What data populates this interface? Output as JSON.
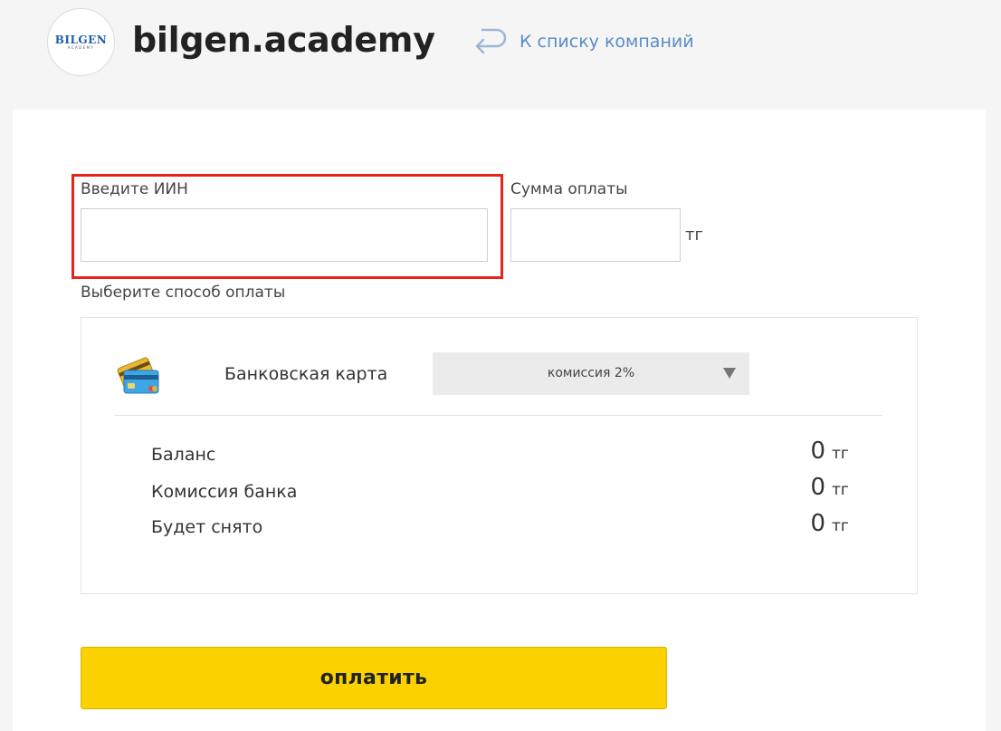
{
  "header": {
    "logo_main": "BILGEN",
    "logo_sub": "ACADEMY",
    "company_name": "bilgen.academy",
    "back_link": "К списку компаний"
  },
  "form": {
    "iin_label": "Введите ИИН",
    "iin_value": "",
    "sum_label": "Сумма оплаты",
    "sum_value": "",
    "sum_unit": "тг",
    "method_label": "Выберите способ оплаты"
  },
  "payment_method": {
    "icon": "credit-card-icon",
    "name": "Банковская карта",
    "commission_selected": "комиссия 2%"
  },
  "summary": [
    {
      "label": "Баланс",
      "value": "0",
      "unit": "тг"
    },
    {
      "label": "Комиссия банка",
      "value": "0",
      "unit": "тг"
    },
    {
      "label": "Будет снято",
      "value": "0",
      "unit": "тг"
    }
  ],
  "pay_button": "оплатить",
  "colors": {
    "accent_yellow": "#fcd100",
    "highlight_red": "#e8231c",
    "link_blue": "#5b8cc4"
  }
}
